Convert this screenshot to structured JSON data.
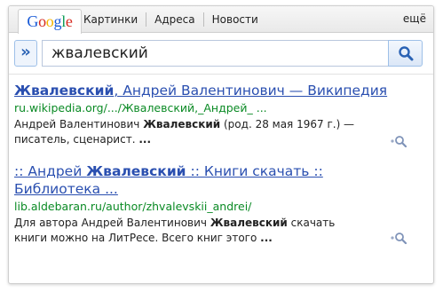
{
  "header": {
    "logo": "Google",
    "logo_colors": [
      "#1a5bd7",
      "#d62a1f",
      "#f4b400",
      "#1a5bd7",
      "#0f9d58",
      "#d62a1f"
    ],
    "nav": [
      "Картинки",
      "Адреса",
      "Новости"
    ],
    "more": "ещё"
  },
  "search": {
    "expand_label": "»",
    "query": "жвалевский"
  },
  "results": [
    {
      "title_bold": "Жвалевский",
      "title_rest": ", Андрей Валентинович — Википедия",
      "url": "ru.wikipedia.org/.../Жвалевский,_Андрей_ ...",
      "snippet_before": "Андрей Валентинович ",
      "snippet_bold": "Жвалевский",
      "snippet_after": " (род. 28 мая 1967 г.) — писатель, сценарист. ",
      "ellipsis": "..."
    },
    {
      "title_pre": ":: Андрей ",
      "title_bold": "Жвалевский",
      "title_rest": " :: Книги скачать :: Библиотека ...",
      "url": "lib.aldebaran.ru/author/zhvalevskii_andrei/",
      "snippet_before": "Для автора Андрей Валентинович ",
      "snippet_bold": "Жвалевский",
      "snippet_after": " скачать книги можно на ЛитРесе. Всего книг этого ",
      "ellipsis": "..."
    }
  ]
}
